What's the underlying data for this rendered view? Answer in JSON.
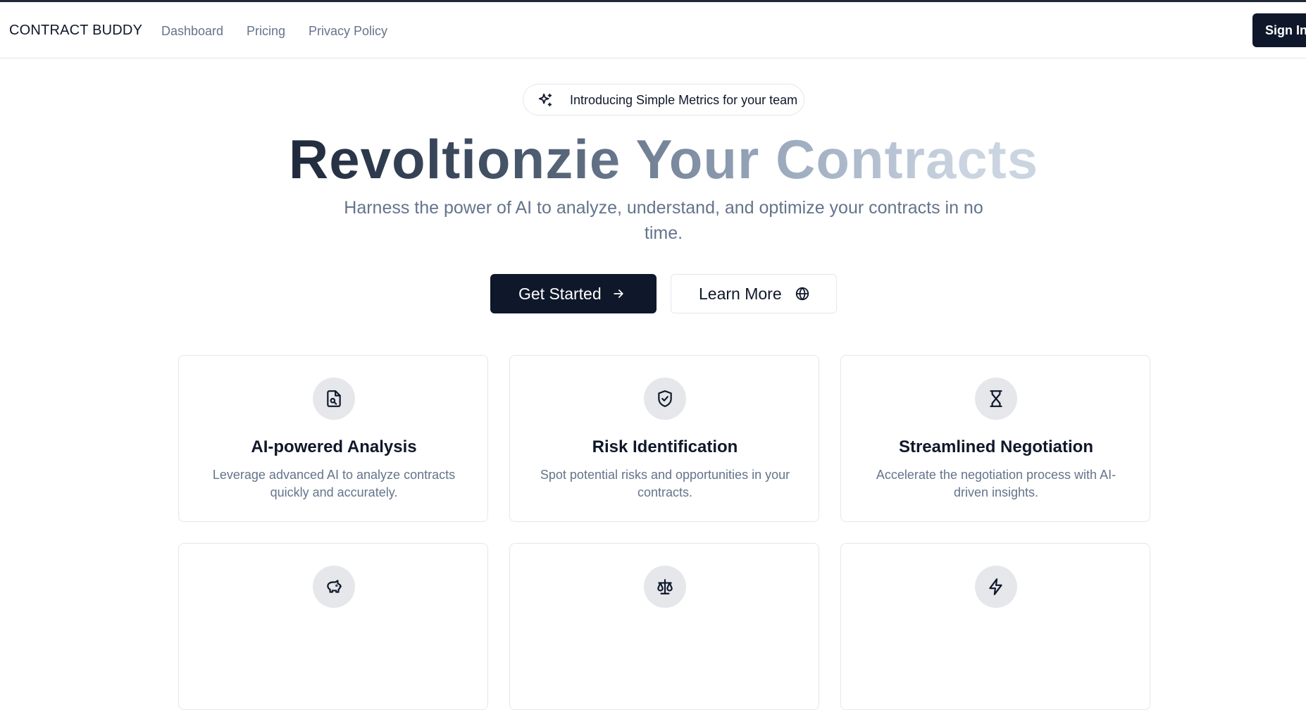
{
  "nav": {
    "brand": "CONTRACT BUDDY",
    "links": [
      "Dashboard",
      "Pricing",
      "Privacy Policy"
    ],
    "signin_label": "Sign In"
  },
  "announcement": {
    "icon": "sparkles-icon",
    "text": "Introducing Simple Metrics for your team"
  },
  "hero": {
    "title": "Revoltionzie Your Contracts",
    "subtitle": "Harness the power of AI to analyze, understand, and optimize your contracts in no time.",
    "primary_button": {
      "label": "Get Started",
      "icon": "arrow-right-icon"
    },
    "secondary_button": {
      "label": "Learn More",
      "icon": "globe-icon"
    }
  },
  "features": [
    {
      "icon": "file-search-icon",
      "title": "AI-powered Analysis",
      "description": "Leverage advanced AI to analyze contracts quickly and accurately."
    },
    {
      "icon": "shield-check-icon",
      "title": "Risk Identification",
      "description": "Spot potential risks and opportunities in your contracts."
    },
    {
      "icon": "hourglass-icon",
      "title": "Streamlined Negotiation",
      "description": "Accelerate the negotiation process with AI-driven insights."
    },
    {
      "icon": "piggy-bank-icon",
      "title": "",
      "description": ""
    },
    {
      "icon": "scale-icon",
      "title": "",
      "description": ""
    },
    {
      "icon": "zap-icon",
      "title": "",
      "description": ""
    }
  ],
  "colors": {
    "primary": "#0f172a",
    "muted_text": "#64748b",
    "border": "#e5e7eb",
    "icon_bg": "#e5e7eb"
  }
}
